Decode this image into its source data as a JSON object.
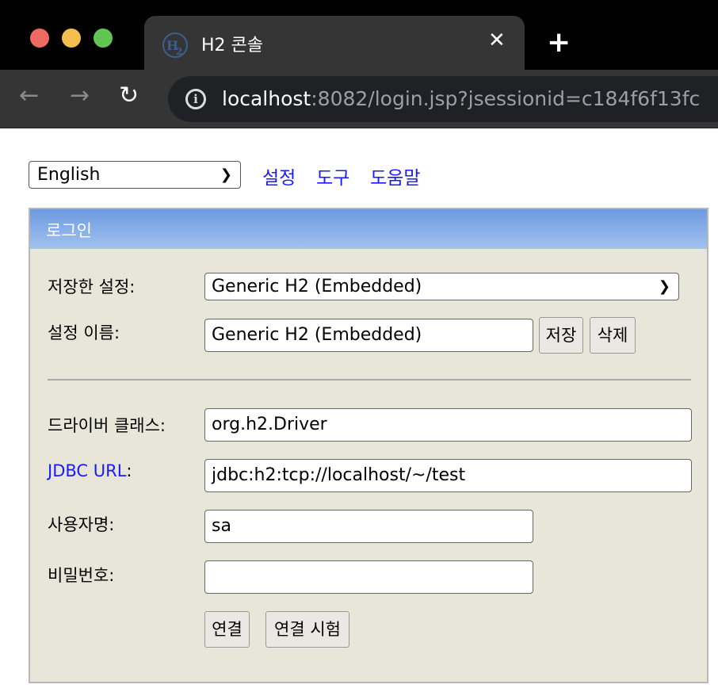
{
  "browser": {
    "tab_title": "H2 콘솔",
    "tab_close": "✕",
    "new_tab": "+",
    "url_host": "localhost",
    "url_rest": ":8082/login.jsp?jsessionid=c184f6f13fc",
    "icons": {
      "back": "←",
      "forward": "→",
      "reload": "↻",
      "info": "i"
    }
  },
  "page": {
    "language": {
      "selected": "English"
    },
    "nav_links": [
      "설정",
      "도구",
      "도움말"
    ],
    "login": {
      "header": "로그인",
      "saved_settings": {
        "label": "저장한 설정:",
        "value": "Generic H2 (Embedded)"
      },
      "setting_name": {
        "label": "설정 이름:",
        "value": "Generic H2 (Embedded)",
        "save_button": "저장",
        "delete_button": "삭제"
      },
      "driver_class": {
        "label": "드라이버 클래스:",
        "value": "org.h2.Driver"
      },
      "jdbc_url": {
        "label": "JDBC URL",
        "label_suffix": ":",
        "value": "jdbc:h2:tcp://localhost/~/test"
      },
      "username": {
        "label": "사용자명:",
        "value": "sa"
      },
      "password": {
        "label": "비밀번호:",
        "value": ""
      },
      "connect_button": "연결",
      "test_button": "연결 시험"
    }
  },
  "colors": {
    "link": "#1a1aff",
    "panel": "#e8e6d8",
    "header_top": "#6d9be0",
    "header_bottom": "#a2c2f0"
  }
}
